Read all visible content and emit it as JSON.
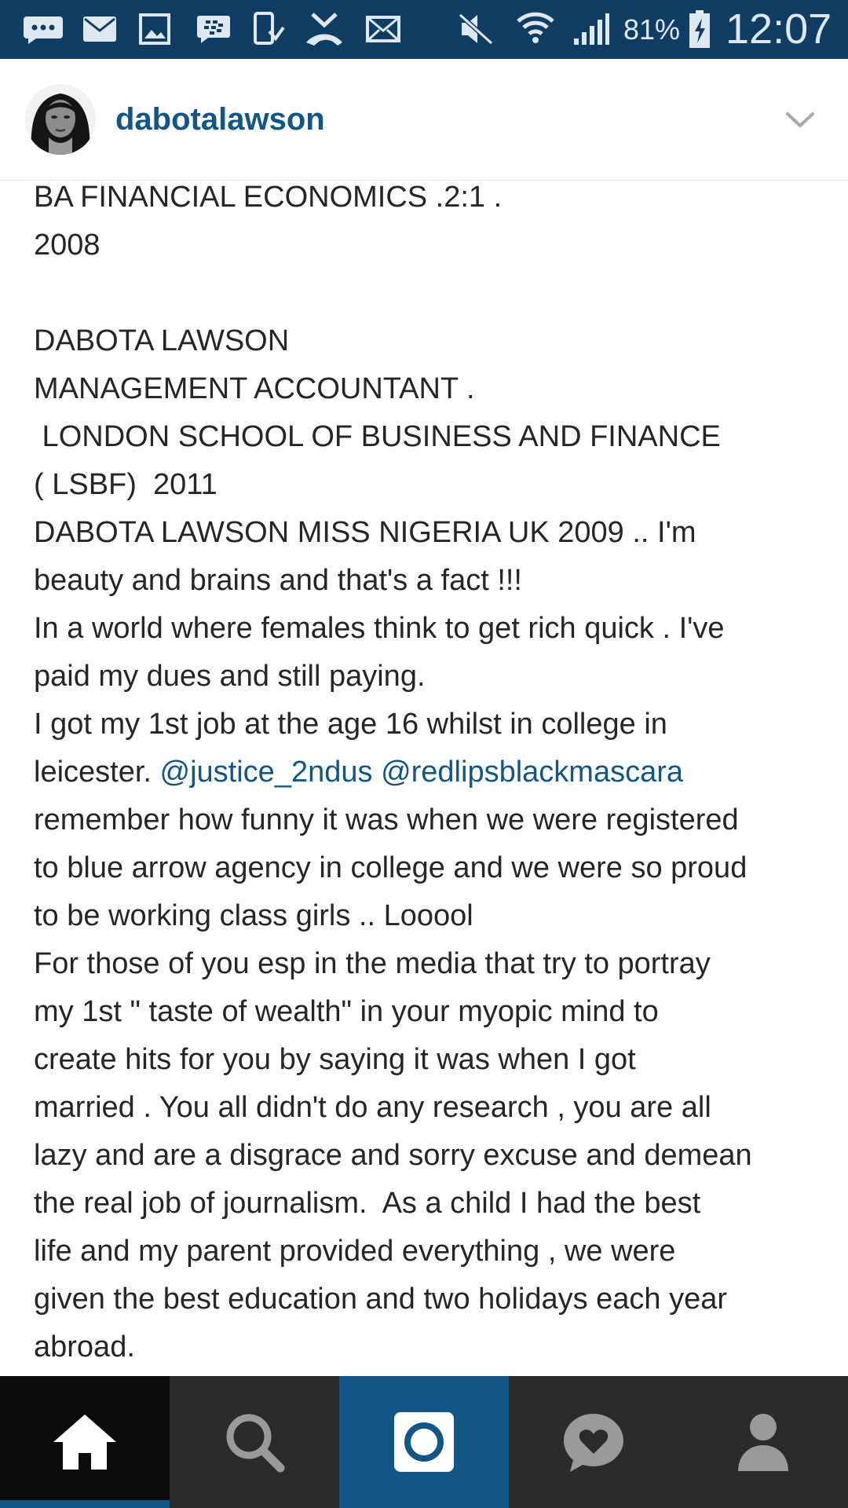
{
  "status_bar": {
    "battery_percent": "81%",
    "time": "12:07",
    "icons": [
      "chat-bubble-icon",
      "email-icon",
      "image-icon",
      "bbm-icon",
      "download-icon",
      "missed-call-icon",
      "mail-icon",
      "mute-icon",
      "wifi-icon",
      "signal-icon",
      "battery-charging-icon"
    ]
  },
  "post": {
    "username": "dabotalawson",
    "avatar": "profile-avatar",
    "dropdown_icon": "chevron-down-icon"
  },
  "caption": {
    "lines": [
      {
        "text": "BA FINANCIAL ECONOMICS .2:1 ."
      },
      {
        "text": "2008"
      },
      {
        "text": ""
      },
      {
        "text": "DABOTA LAWSON"
      },
      {
        "text": "MANAGEMENT ACCOUNTANT ."
      },
      {
        "text": " LONDON SCHOOL OF BUSINESS AND FINANCE"
      },
      {
        "text": "( LSBF)  2011"
      },
      {
        "text": "DABOTA LAWSON MISS NIGERIA UK 2009 .. I'm"
      },
      {
        "text": "beauty and brains and that's a fact !!!"
      },
      {
        "text": "In a world where females think to get rich quick . I've"
      },
      {
        "text": "paid my dues and still paying."
      },
      {
        "text": "I got my 1st job at the age 16 whilst in college in"
      },
      {
        "text": "leicester. ",
        "mentions": [
          "@justice_2ndus",
          "@redlipsblackmascara"
        ]
      },
      {
        "text": "remember how funny it was when we were registered"
      },
      {
        "text": "to blue arrow agency in college and we were so proud"
      },
      {
        "text": "to be working class girls .. Looool"
      },
      {
        "text": "For those of you esp in the media that try to portray"
      },
      {
        "text": "my 1st \" taste of wealth\" in your myopic mind to"
      },
      {
        "text": "create hits for you by saying it was when I got"
      },
      {
        "text": "married . You all didn't do any research , you are all"
      },
      {
        "text": "lazy and are a disgrace and sorry excuse and demean"
      },
      {
        "text": "the real job of journalism.  As a child I had the best"
      },
      {
        "text": "life and my parent provided everything , we were"
      },
      {
        "text": "given the best education and two holidays each year"
      },
      {
        "text": "abroad."
      }
    ]
  },
  "bottom_nav": {
    "tabs": [
      {
        "name": "home",
        "icon": "home-icon",
        "active": true
      },
      {
        "name": "search",
        "icon": "search-icon",
        "active": false
      },
      {
        "name": "camera",
        "icon": "camera-icon",
        "active": false
      },
      {
        "name": "activity",
        "icon": "heart-bubble-icon",
        "active": false
      },
      {
        "name": "profile",
        "icon": "person-icon",
        "active": false
      }
    ]
  },
  "colors": {
    "status_bar": "#0f3d64",
    "link": "#125688",
    "nav_bg": "#2b2b2b",
    "nav_home_bg": "#0d0d0d",
    "nav_camera_bg": "#125688"
  }
}
